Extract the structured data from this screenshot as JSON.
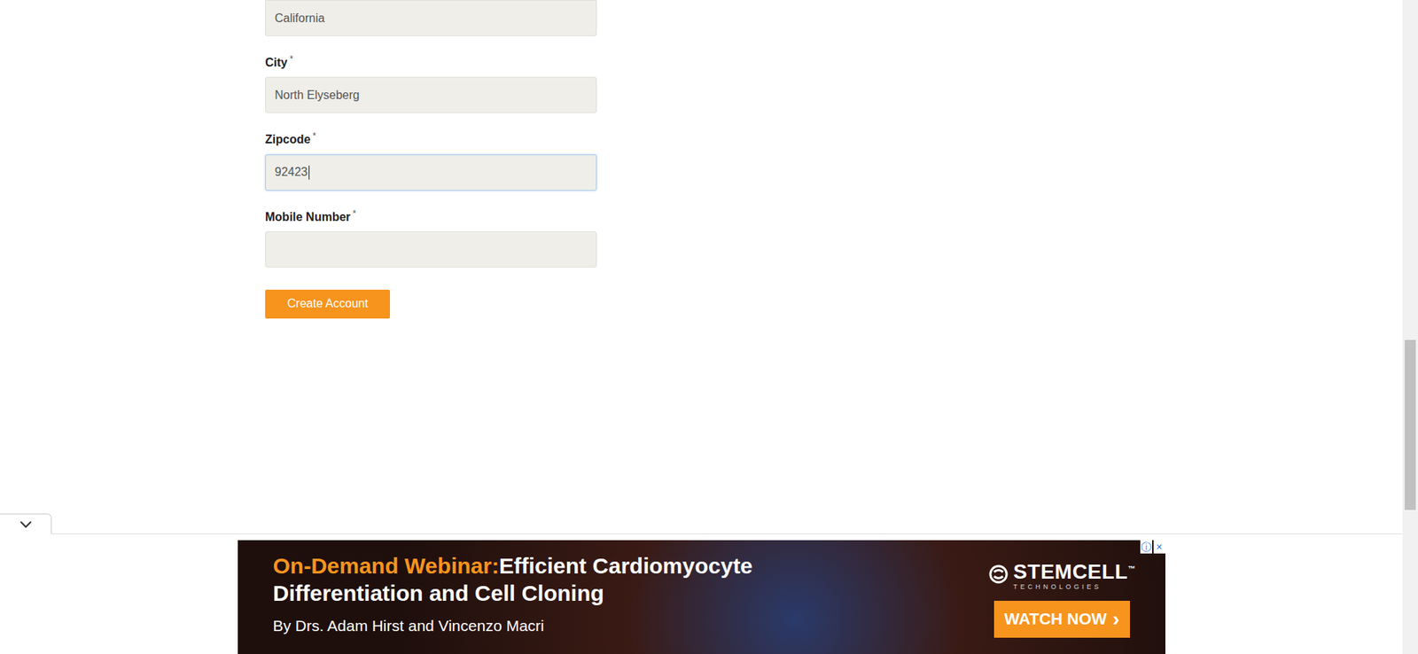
{
  "form": {
    "fields": [
      {
        "label": "",
        "required": false,
        "value": "California",
        "focused": false
      },
      {
        "label": "City",
        "required": true,
        "value": "North Elyseberg",
        "focused": false
      },
      {
        "label": "Zipcode",
        "required": true,
        "value": "92423",
        "focused": true
      },
      {
        "label": "Mobile Number",
        "required": true,
        "value": "",
        "focused": false
      }
    ],
    "required_mark": "*",
    "submit": "Create Account"
  },
  "scrollbar": {
    "thumb_top": 0.52,
    "thumb_size": 0.26
  },
  "ad": {
    "headline_prefix": "On-Demand Webinar:",
    "headline_lines": [
      "Efficient Cardiomyocyte",
      "Differentiation and Cell Cloning"
    ],
    "byline": "By Drs. Adam Hirst and Vincenzo Macri",
    "brand": "STEMCELL",
    "brand_tm": "™",
    "brand_sub": "TECHNOLOGIES",
    "cta": "WATCH NOW",
    "cta_arrow": "›",
    "info": "ⓘ",
    "close": "×"
  }
}
